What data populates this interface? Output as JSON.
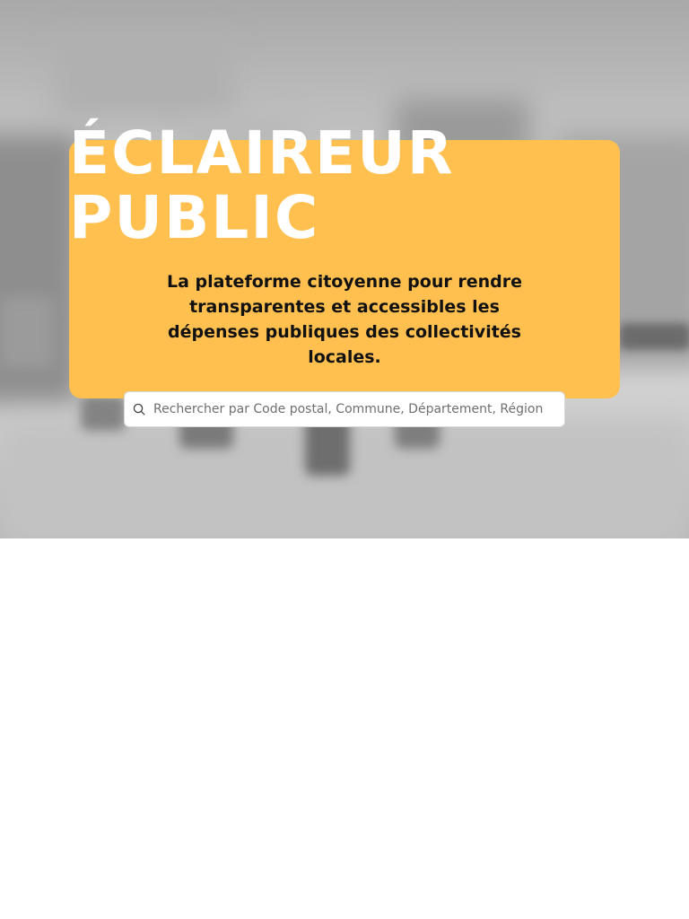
{
  "hero": {
    "title_line1": "ÉCLAIREUR",
    "title_line2": "PUBLIC",
    "subtitle": "La plateforme citoyenne pour rendre transparentes et accessibles les dépenses publiques des collectivités locales.",
    "accent_color": "#ffc050"
  },
  "search": {
    "icon": "search-icon",
    "placeholder": "Rechercher par Code postal, Commune, Département, Région",
    "value": ""
  }
}
